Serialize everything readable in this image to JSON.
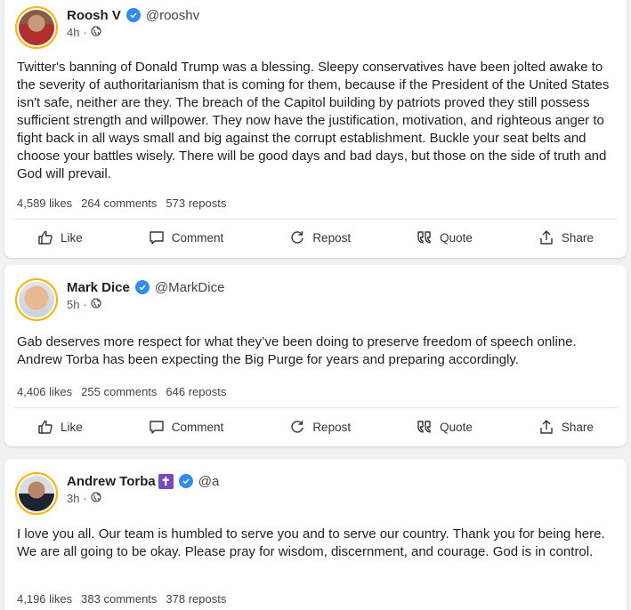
{
  "posts": [
    {
      "author": "Roosh V",
      "handle": "@rooshv",
      "time": "4h",
      "separator": "·",
      "text": "Twitter's banning of Donald Trump was a blessing. Sleepy conservatives have been jolted awake to the severity of authoritarianism that is coming for them, because if the President of the United States isn't safe, neither are they. The breach of the Capitol building by patriots proved they still possess sufficient strength and willpower. They now have the justification, motivation, and righteous anger to fight back in all ways small and big against the corrupt establishment. Buckle your seat belts and choose your battles wisely. There will be good days and bad days, but those on the side of truth and God will prevail.",
      "likes": "4,589 likes",
      "comments": "264 comments",
      "reposts": "573 reposts"
    },
    {
      "author": "Mark Dice",
      "handle": "@MarkDice",
      "time": "5h",
      "separator": "·",
      "text": "Gab deserves more respect for what they’ve been doing to preserve freedom of speech online. Andrew Torba has been expecting the Big Purge for years and preparing accordingly.",
      "likes": "4,406 likes",
      "comments": "255 comments",
      "reposts": "646 reposts"
    },
    {
      "author": "Andrew Torba",
      "badge": "✝",
      "handle": "@a",
      "time": "3h",
      "separator": "·",
      "text": "I love you all. Our team is humbled to serve you and to serve our country. Thank you for being here. We are all going to be okay. Please pray for wisdom, discernment, and courage. God is in control.",
      "likes": "4,196 likes",
      "comments": "383 comments",
      "reposts": "378 reposts"
    }
  ],
  "actions": {
    "like": "Like",
    "comment": "Comment",
    "repost": "Repost",
    "quote": "Quote",
    "share": "Share"
  },
  "icons": {
    "verified": "verified-check-icon",
    "globe": "globe-icon",
    "like": "thumbs-up-icon",
    "comment": "comment-icon",
    "repost": "repost-icon",
    "quote": "quote-icon",
    "share": "share-icon"
  },
  "colors": {
    "avatar_ring": "#f7b500",
    "verified": "#2f8cf5",
    "cross_badge": "#7b4ab8"
  }
}
